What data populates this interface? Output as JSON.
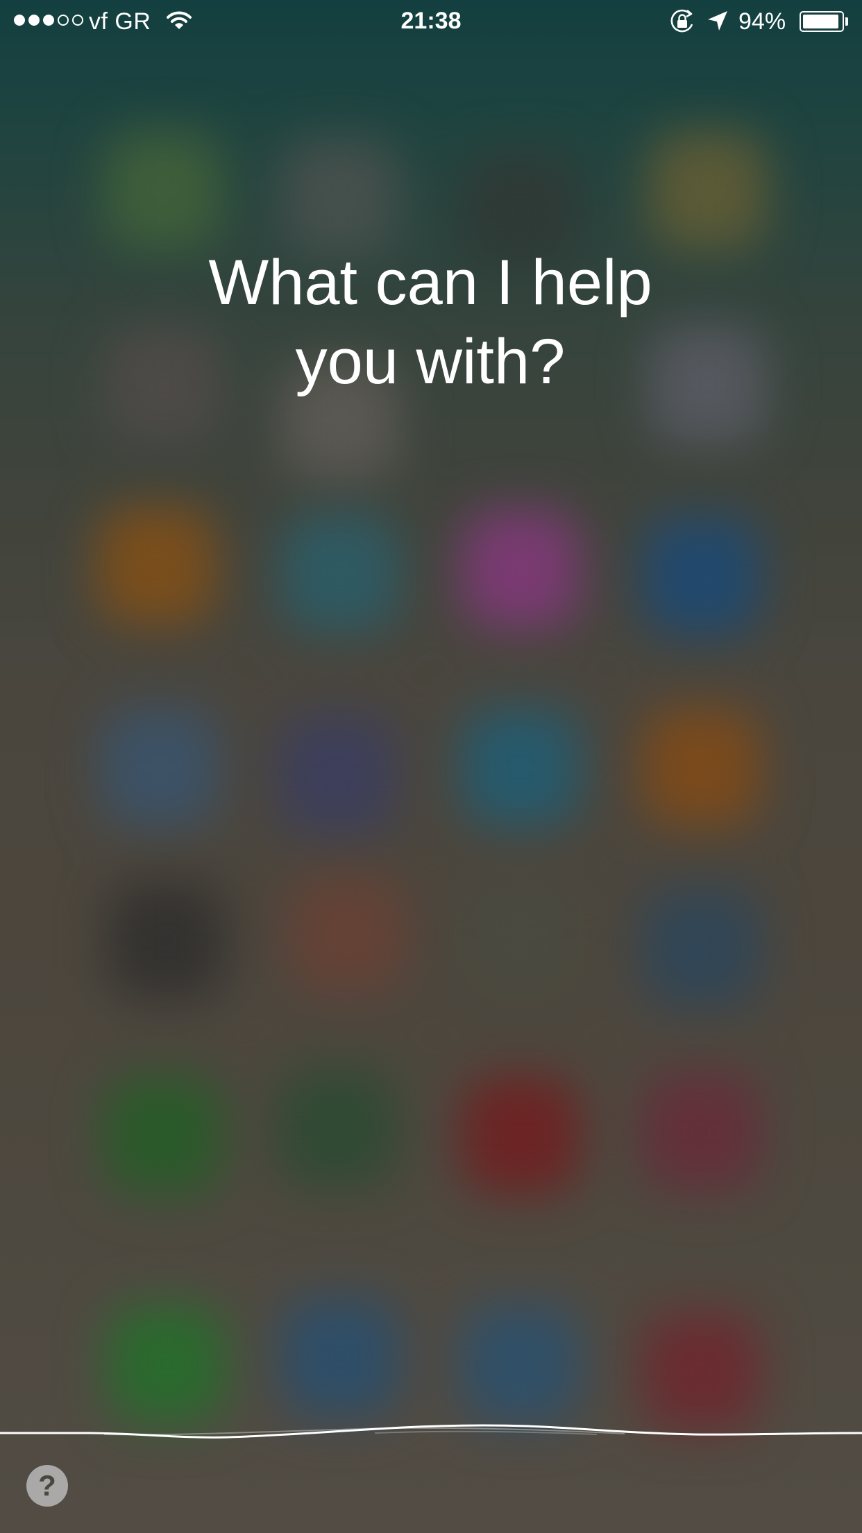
{
  "status_bar": {
    "signal_filled": 3,
    "signal_total": 5,
    "carrier": "vf GR",
    "wifi_icon": "wifi-icon",
    "time": "21:38",
    "rotation_lock_icon": "rotation-lock-icon",
    "location_icon": "location-arrow-icon",
    "battery_percent": "94%",
    "battery_level": 0.94
  },
  "siri": {
    "prompt_line1": "What can I help",
    "prompt_line2": "you with?",
    "help_button_label": "?",
    "help_icon": "question-mark-icon"
  },
  "colors": {
    "background_top": "#133f40",
    "background_bottom": "#524c44",
    "text": "#ffffff"
  }
}
